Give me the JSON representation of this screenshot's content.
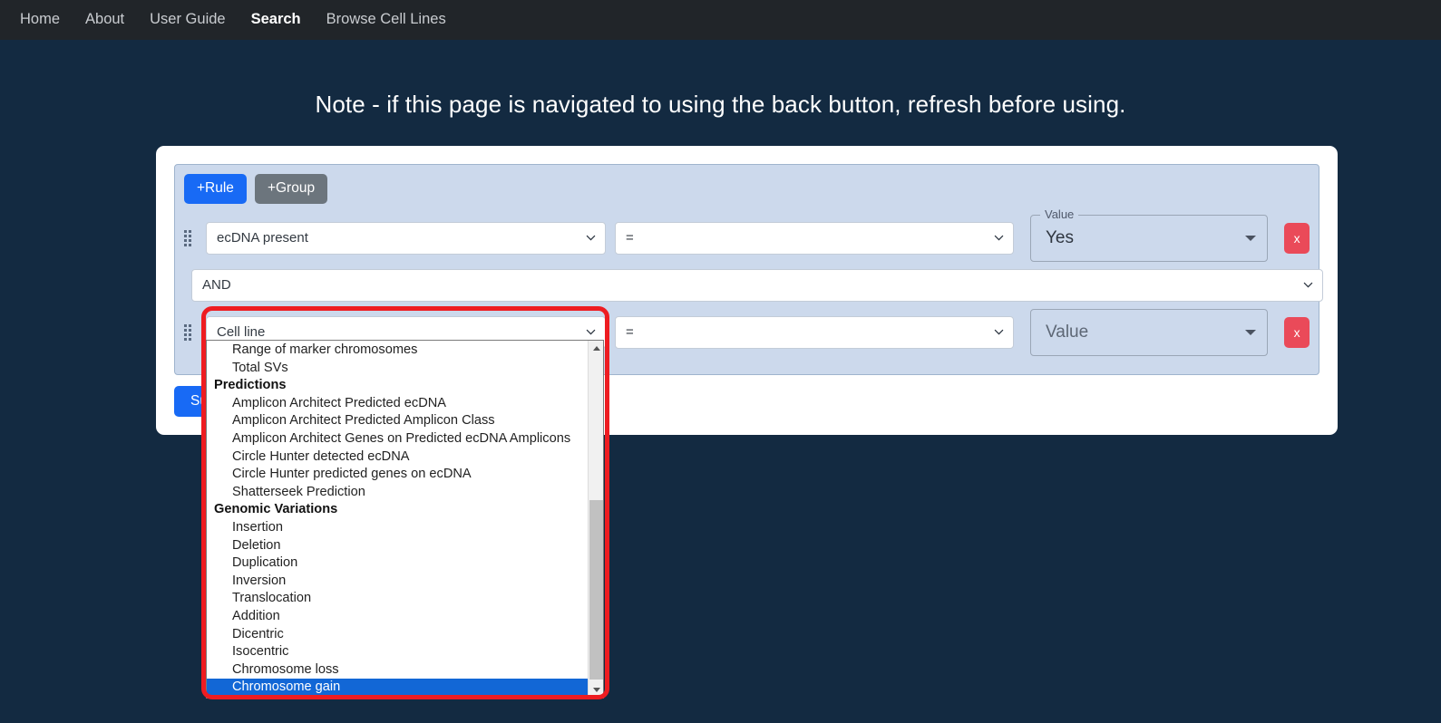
{
  "navbar": {
    "items": [
      {
        "label": "Home",
        "active": false
      },
      {
        "label": "About",
        "active": false
      },
      {
        "label": "User Guide",
        "active": false
      },
      {
        "label": "Search",
        "active": true
      },
      {
        "label": "Browse Cell Lines",
        "active": false
      }
    ]
  },
  "page": {
    "note": "Note - if this page is navigated to using the back button, refresh before using."
  },
  "query_builder": {
    "add_rule_label": "+Rule",
    "add_group_label": "+Group",
    "submit_label": "Submit",
    "conjunction": "AND",
    "delete_label": "x",
    "rules": [
      {
        "field": "ecDNA present",
        "operator": "=",
        "value_legend": "Value",
        "value": "Yes"
      },
      {
        "field": "Cell line",
        "operator": "=",
        "value_legend": "Value",
        "value": "Value"
      }
    ]
  },
  "field_dropdown": {
    "open": true,
    "selected": "Chromosome gain",
    "options": [
      {
        "type": "option",
        "label": "Range of marker chromosomes"
      },
      {
        "type": "option",
        "label": "Total SVs"
      },
      {
        "type": "group",
        "label": "Predictions"
      },
      {
        "type": "option",
        "label": "Amplicon Architect Predicted ecDNA"
      },
      {
        "type": "option",
        "label": "Amplicon Architect Predicted Amplicon Class"
      },
      {
        "type": "option",
        "label": "Amplicon Architect Genes on Predicted ecDNA Amplicons"
      },
      {
        "type": "option",
        "label": "Circle Hunter detected ecDNA"
      },
      {
        "type": "option",
        "label": "Circle Hunter predicted genes on ecDNA"
      },
      {
        "type": "option",
        "label": "Shatterseek Prediction"
      },
      {
        "type": "group",
        "label": "Genomic Variations"
      },
      {
        "type": "option",
        "label": "Insertion"
      },
      {
        "type": "option",
        "label": "Deletion"
      },
      {
        "type": "option",
        "label": "Duplication"
      },
      {
        "type": "option",
        "label": "Inversion"
      },
      {
        "type": "option",
        "label": "Translocation"
      },
      {
        "type": "option",
        "label": "Addition"
      },
      {
        "type": "option",
        "label": "Dicentric"
      },
      {
        "type": "option",
        "label": "Isocentric"
      },
      {
        "type": "option",
        "label": "Chromosome loss"
      },
      {
        "type": "option",
        "label": "Chromosome gain"
      }
    ]
  },
  "colors": {
    "page_background": "#132a41",
    "navbar_background": "#212529",
    "panel_background": "#ccd9ec",
    "primary_button": "#186af5",
    "secondary_button": "#6c757d",
    "delete_button": "#ea4a59",
    "dropdown_highlight": "#1267d6",
    "annotation_outline": "#ee1c21"
  }
}
